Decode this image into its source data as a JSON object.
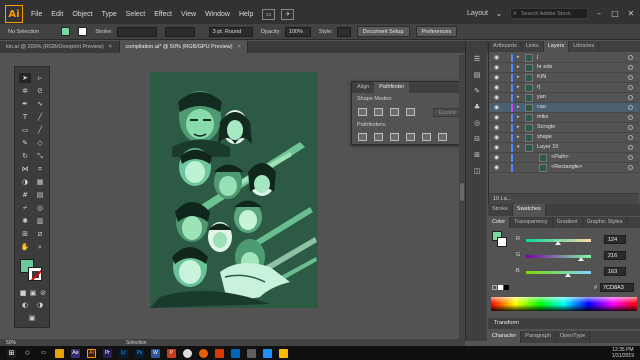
{
  "app": {
    "logo": "Ai",
    "menu": [
      "File",
      "Edit",
      "Object",
      "Type",
      "Select",
      "Effect",
      "View",
      "Window",
      "Help"
    ],
    "workspace": "Layout",
    "search_placeholder": "Search Adobe Stock"
  },
  "control_bar": {
    "selection": "No Selection",
    "stroke_label": "Stroke:",
    "brush": "3 pt. Round",
    "opacity_label": "Opacity:",
    "opacity": "100%",
    "style_label": "Style:",
    "doc_setup": "Document Setup",
    "preferences": "Preferences"
  },
  "doc_tabs": [
    {
      "label": "kin.ai @ 200% (RGB/Overprint Preview)"
    },
    {
      "label": "compilation.ai* @ 50% (RGB/GPU Preview)"
    }
  ],
  "pathfinder": {
    "tabs": [
      "Align",
      "Pathfinder"
    ],
    "shape_modes": "Shape Modes:",
    "pathfinders": "Pathfinders:",
    "expand": "Expand"
  },
  "layers_panel": {
    "tabs": [
      "Artboards",
      "Links",
      "Layers",
      "Libraries"
    ],
    "rows": [
      {
        "name": "j",
        "color": "#4b8bff"
      },
      {
        "name": "hr eds",
        "color": "#4b8bff"
      },
      {
        "name": "KIN",
        "color": "#4b8bff"
      },
      {
        "name": "rj",
        "color": "#4b8bff"
      },
      {
        "name": "yan",
        "color": "#4b8bff"
      },
      {
        "name": "cao",
        "color": "#c64bff"
      },
      {
        "name": "miks",
        "color": "#4b8bff"
      },
      {
        "name": "Scrsgle",
        "color": "#4b8bff"
      },
      {
        "name": "shape",
        "color": "#4b8bff"
      },
      {
        "name": "Layer 10",
        "color": "#4b8bff"
      },
      {
        "name": "<Path>",
        "color": "#4b8bff"
      },
      {
        "name": "<Rectangle>",
        "color": "#4b8bff"
      }
    ],
    "footer": "10 La..."
  },
  "stroke_tabs": [
    "Stroke",
    "Swatches"
  ],
  "color_panel": {
    "tabs": [
      "Color",
      "Transparency",
      "Gradient",
      "Graphic Styles"
    ],
    "r": "124",
    "g": "216",
    "b": "163",
    "hex": "7CD8A3",
    "r_frac": 0.486,
    "g_frac": 0.847,
    "b_frac": 0.639,
    "colors": {
      "fill": "#7cd8a3",
      "artboard": "#2c5a44"
    }
  },
  "transform_tab": "Transform",
  "character_tabs": [
    "Character",
    "Paragraph",
    "OpenType"
  ],
  "status": {
    "zoom": "50%",
    "tool": "Selection"
  },
  "clock": {
    "time": "12:35 PM",
    "date": "1/31/2019"
  }
}
